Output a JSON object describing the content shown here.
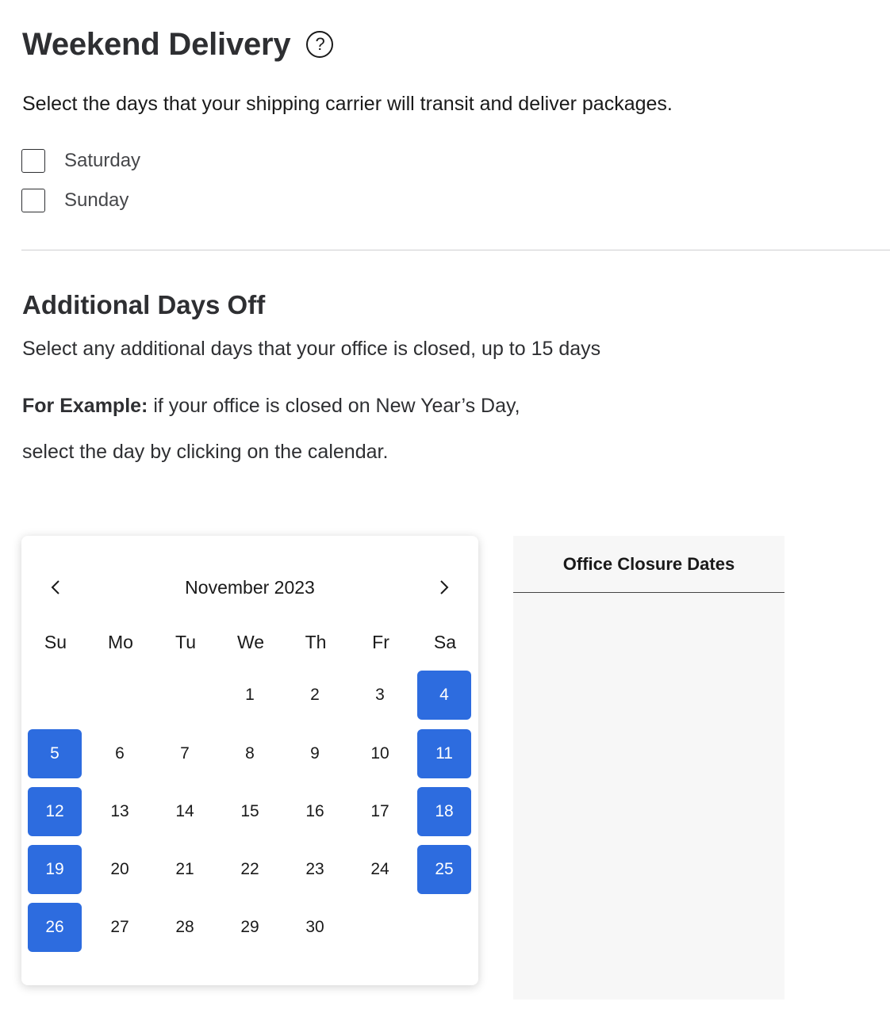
{
  "weekend_delivery": {
    "title": "Weekend Delivery",
    "help_icon": "question-circle-icon",
    "description": "Select the days that your shipping carrier will transit and deliver packages.",
    "options": [
      {
        "label": "Saturday",
        "checked": false
      },
      {
        "label": "Sunday",
        "checked": false
      }
    ]
  },
  "additional_days_off": {
    "title": "Additional Days Off",
    "description": "Select any additional days that your office is closed, up to 15 days",
    "example_bold": "For Example:",
    "example_text": " if your office is closed on New Year’s Day,",
    "example_line2": "select the day by clicking on the calendar."
  },
  "calendar": {
    "month_label": "November 2023",
    "prev_icon": "chevron-left-icon",
    "next_icon": "chevron-right-icon",
    "weekdays": [
      "Su",
      "Mo",
      "Tu",
      "We",
      "Th",
      "Fr",
      "Sa"
    ],
    "first_weekday_index": 3,
    "days_in_month": 30,
    "selected_days": [
      4,
      5,
      11,
      12,
      18,
      19,
      25,
      26
    ],
    "selected_color": "#2d6cdf"
  },
  "closure_panel": {
    "header": "Office Closure Dates",
    "dates": []
  }
}
